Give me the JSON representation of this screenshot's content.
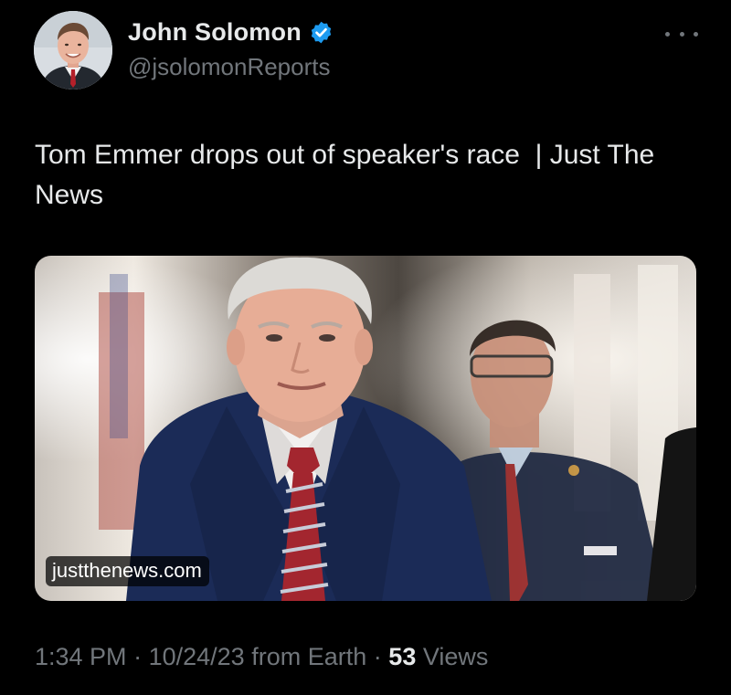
{
  "author": {
    "display_name": "John Solomon",
    "handle": "@jsolomonReports",
    "verified_icon": "verified-badge-icon",
    "avatar": "profile-photo"
  },
  "more_icon": "more-options-icon",
  "tweet_text": "Tom Emmer drops out of speaker's race  | Just The News",
  "media": {
    "source_domain": "justthenews.com",
    "image": "photo"
  },
  "meta": {
    "time": "1:34 PM",
    "separator": "·",
    "date": "10/24/23",
    "source": "from Earth",
    "views_count": "53",
    "views_label": "Views"
  },
  "colors": {
    "background": "#000000",
    "text_primary": "#e7e9ea",
    "text_secondary": "#71767b",
    "verified_blue": "#1d9bf0"
  }
}
